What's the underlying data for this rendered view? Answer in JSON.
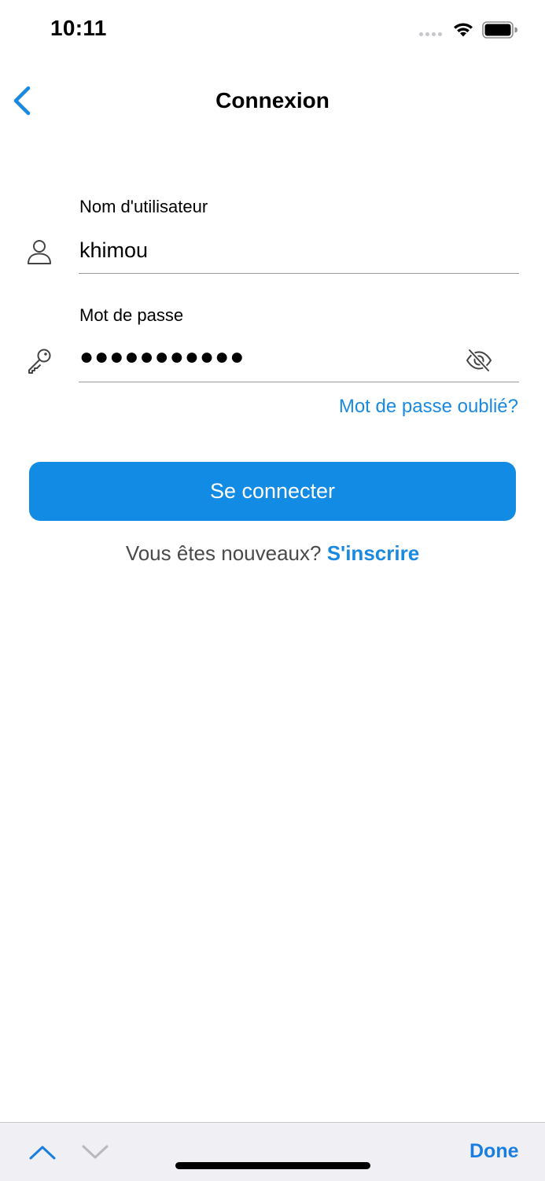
{
  "status_bar": {
    "time": "10:11"
  },
  "nav": {
    "title": "Connexion",
    "back_icon": "chevron-left-icon"
  },
  "form": {
    "username_label": "Nom d'utilisateur",
    "username_value": "khimou",
    "username_icon": "person-icon",
    "password_label": "Mot de passe",
    "password_value": "●●●●●●●●●●●",
    "password_icon": "key-icon",
    "visibility_icon": "eye-slash-icon",
    "forgot_password": "Mot de passe oublié?"
  },
  "actions": {
    "login_label": "Se connecter",
    "signup_prompt": "Vous êtes nouveaux? ",
    "signup_link": "S'inscrire"
  },
  "keyboard_accessory": {
    "done_label": "Done",
    "prev_icon": "chevron-up-icon",
    "next_icon": "chevron-down-icon"
  },
  "colors": {
    "accent": "#128be4",
    "link": "#1a8ae0",
    "accessory_bg": "#efeff4"
  }
}
